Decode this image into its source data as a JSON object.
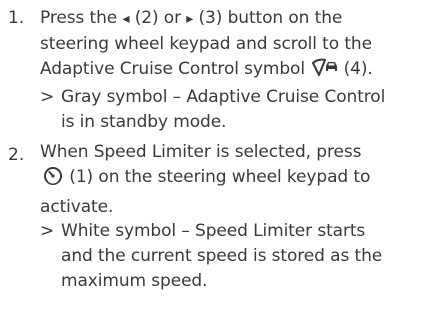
{
  "steps": [
    {
      "number": "1.",
      "lines": {
        "l1_a": "Press the ",
        "l1_left_arrow": "◂",
        "l1_b": " (2) or ",
        "l1_right_arrow": "▸",
        "l1_c": " (3) button on the",
        "l2": "steering wheel keypad and scroll to the",
        "l3_a": "Adaptive Cruise Control symbol ",
        "l3_b": " (4)."
      },
      "icon": "adaptive-cruise-control-icon",
      "result": {
        "marker": ">",
        "l1": "Gray symbol – Adaptive Cruise Control",
        "l2": "is in standby mode."
      }
    },
    {
      "number": "2.",
      "lines": {
        "l1": "When Speed Limiter is selected, press",
        "l2_b": " (1) on the steering wheel keypad to",
        "l3": "activate."
      },
      "icon": "speed-limiter-icon",
      "result": {
        "marker": ">",
        "l1": "White symbol – Speed Limiter starts",
        "l2": "and the current speed is stored as the",
        "l3": "maximum speed."
      }
    }
  ]
}
